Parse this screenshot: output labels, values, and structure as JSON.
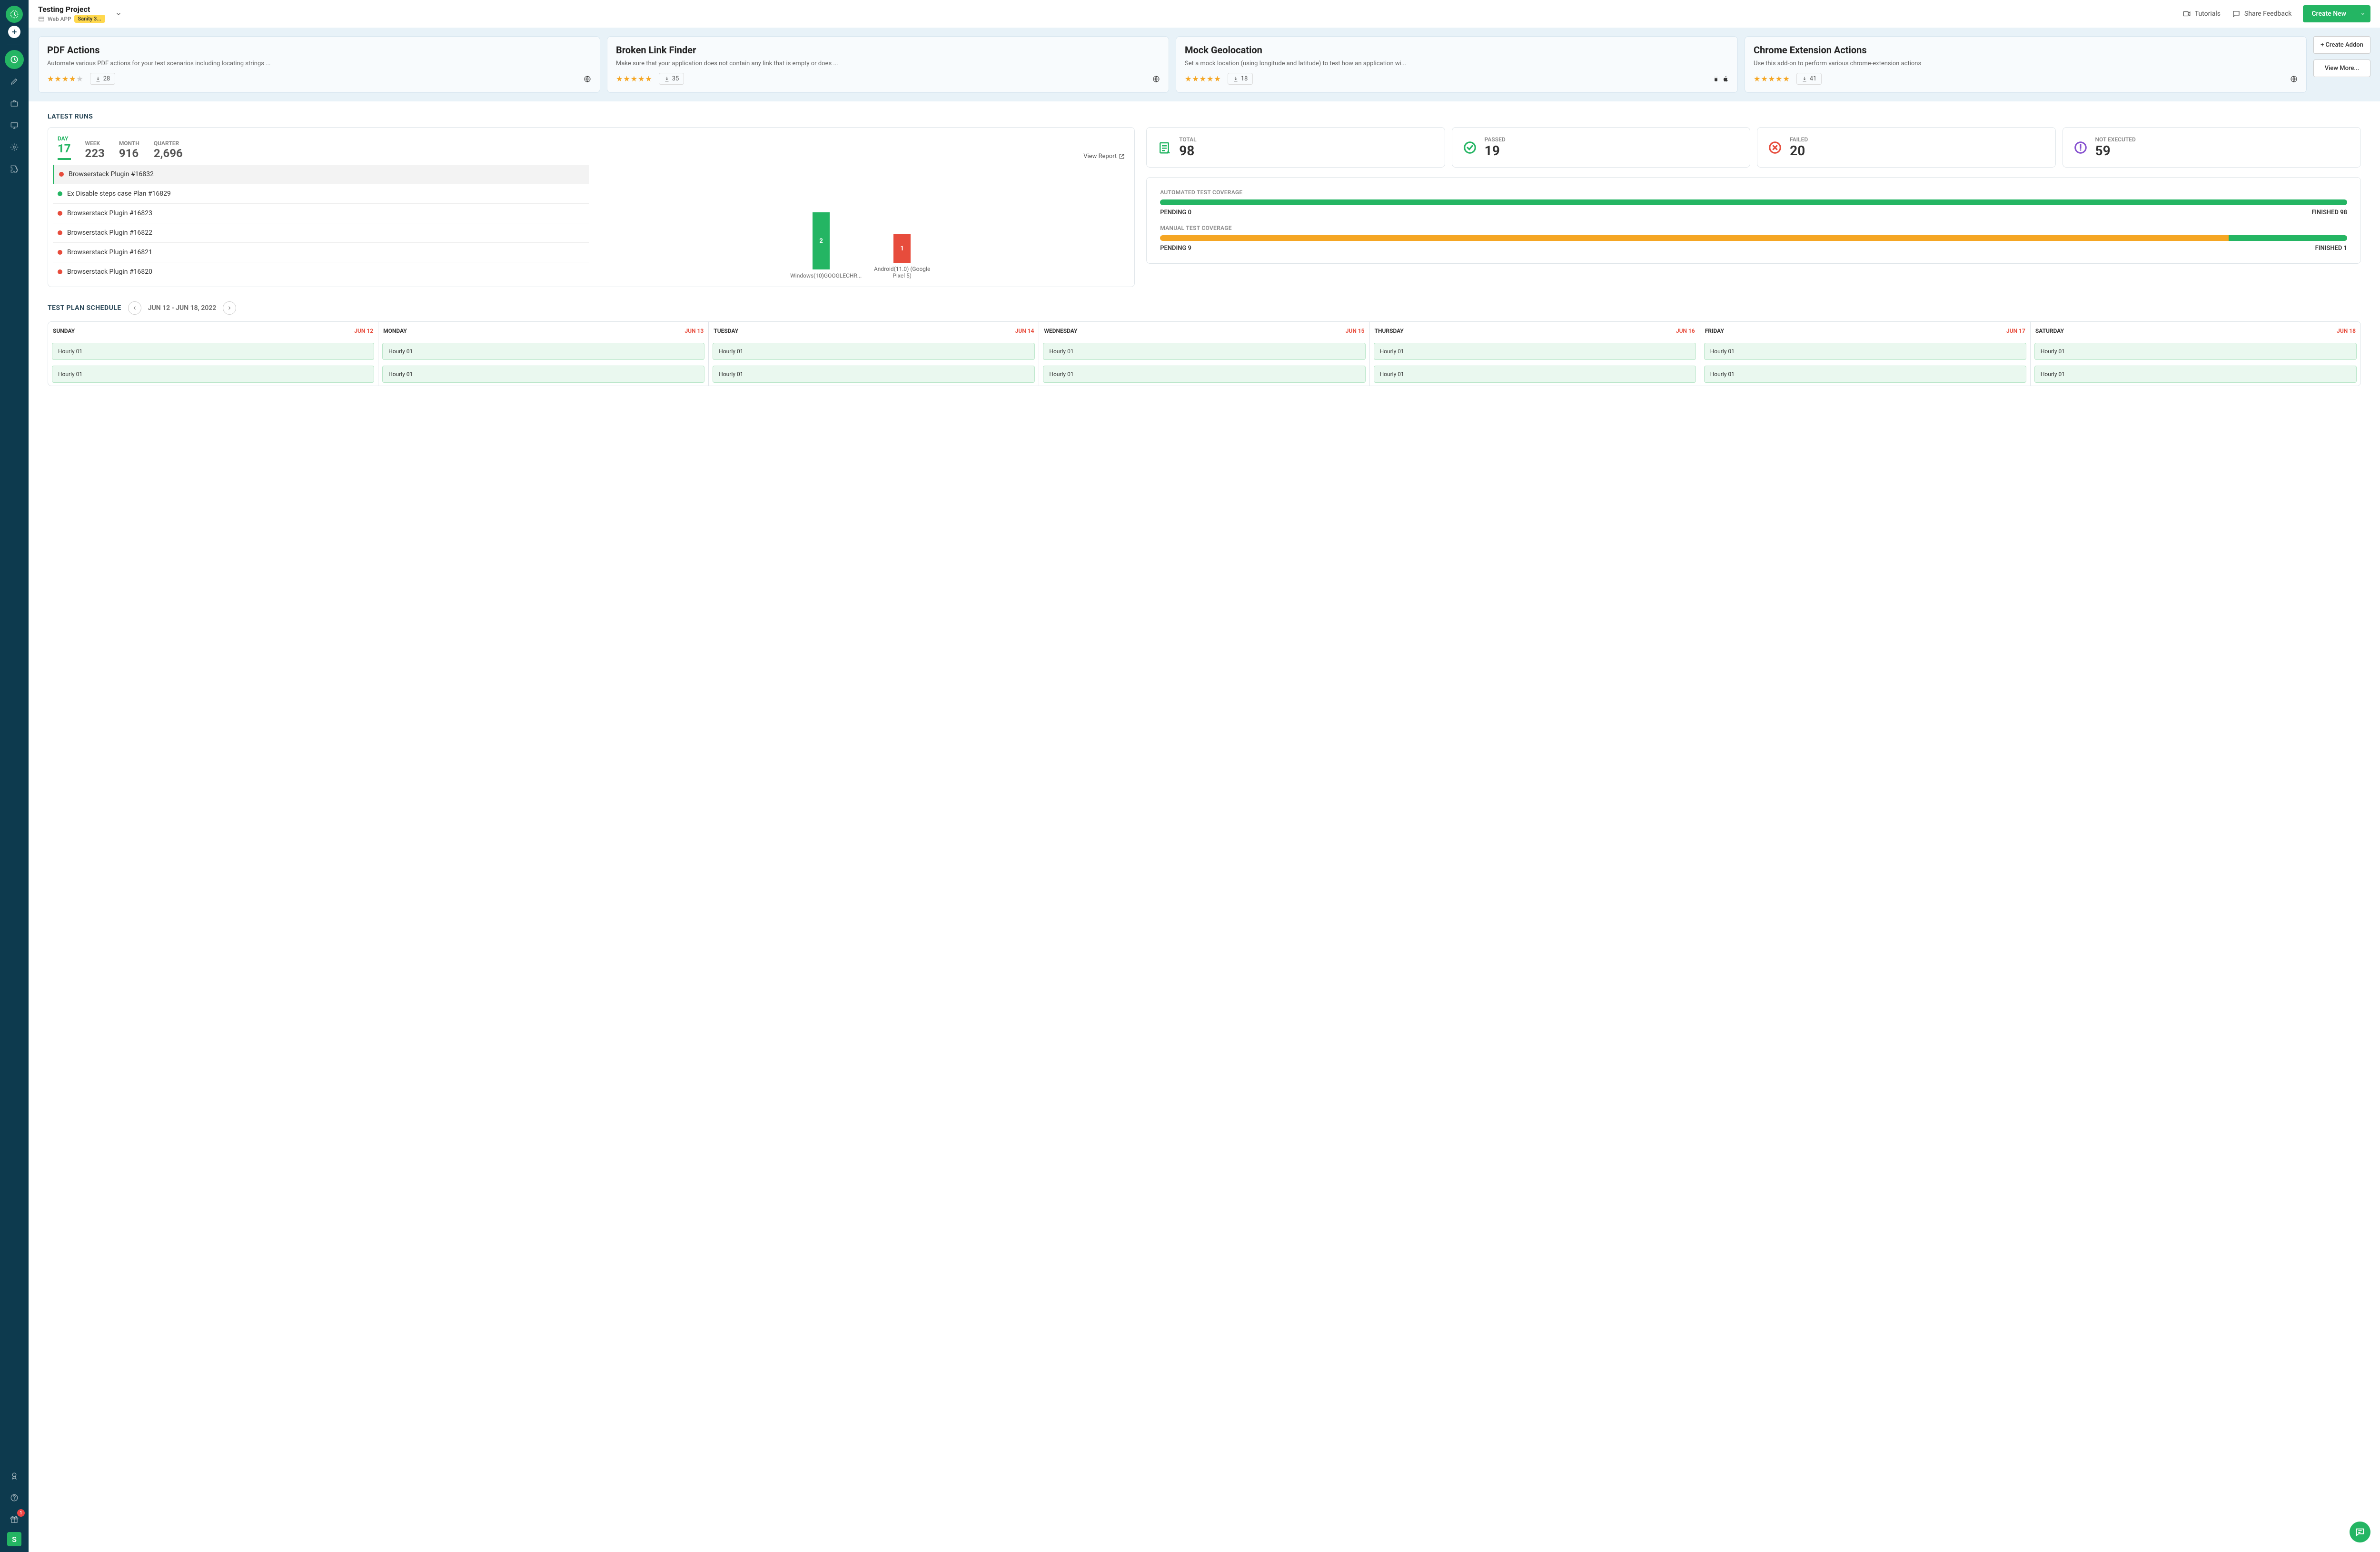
{
  "project": {
    "title": "Testing Project",
    "type": "Web APP",
    "badge": "Sanity 3..."
  },
  "topbar": {
    "tutorials": "Tutorials",
    "feedback": "Share Feedback",
    "create": "Create New"
  },
  "addons": [
    {
      "title": "PDF Actions",
      "desc": "Automate various PDF actions for your test scenarios including locating strings ...",
      "rating": 4,
      "downloads": "28",
      "platforms": [
        "web"
      ]
    },
    {
      "title": "Broken Link Finder",
      "desc": "Make sure that your application does not contain any link that is empty or does ...",
      "rating": 5,
      "downloads": "35",
      "platforms": [
        "web"
      ]
    },
    {
      "title": "Mock Geolocation",
      "desc": "Set a mock location (using longitude and latitude) to test how an application wi...",
      "rating": 5,
      "downloads": "18",
      "platforms": [
        "android",
        "apple"
      ]
    },
    {
      "title": "Chrome Extension Actions",
      "desc": "Use this add-on to perform various chrome-extension actions",
      "rating": 5,
      "downloads": "41",
      "platforms": [
        "web"
      ]
    }
  ],
  "addons_side": {
    "create": "+ Create Addon",
    "more": "View More..."
  },
  "latest_runs": {
    "title": "LATEST RUNS",
    "view_report": "View Report"
  },
  "periods": [
    {
      "label": "DAY",
      "value": "17",
      "active": true
    },
    {
      "label": "WEEK",
      "value": "223"
    },
    {
      "label": "MONTH",
      "value": "916"
    },
    {
      "label": "QUARTER",
      "value": "2,696"
    }
  ],
  "runs": [
    {
      "name": "Browserstack Plugin #16832",
      "status": "red"
    },
    {
      "name": "Ex Disable steps case Plan #16829",
      "status": "green"
    },
    {
      "name": "Browserstack Plugin #16823",
      "status": "red"
    },
    {
      "name": "Browserstack Plugin #16822",
      "status": "red"
    },
    {
      "name": "Browserstack Plugin #16821",
      "status": "red"
    },
    {
      "name": "Browserstack Plugin #16820",
      "status": "red"
    }
  ],
  "chart_data": {
    "type": "bar",
    "categories": [
      "Windows(10)GOOGLECHR...",
      "Android(11.0) (Google Pixel 5)"
    ],
    "values": [
      2,
      1
    ],
    "colors": [
      "#24b563",
      "#e74c3c"
    ]
  },
  "stats": {
    "total": {
      "label": "TOTAL",
      "value": "98"
    },
    "passed": {
      "label": "PASSED",
      "value": "19"
    },
    "failed": {
      "label": "FAILED",
      "value": "20"
    },
    "not_executed": {
      "label": "NOT EXECUTED",
      "value": "59"
    }
  },
  "coverage": {
    "auto": {
      "title": "AUTOMATED TEST COVERAGE",
      "pending": "PENDING 0",
      "finished": "FINISHED 98"
    },
    "manual": {
      "title": "MANUAL TEST COVERAGE",
      "pending": "PENDING 9",
      "finished": "FINISHED 1"
    }
  },
  "schedule": {
    "title": "TEST PLAN SCHEDULE",
    "range": "JUN 12 - JUN 18, 2022"
  },
  "days": [
    {
      "name": "SUNDAY",
      "date": "JUN 12",
      "events": [
        "Hourly 01",
        "Hourly 01"
      ]
    },
    {
      "name": "MONDAY",
      "date": "JUN 13",
      "events": [
        "Hourly 01",
        "Hourly 01"
      ]
    },
    {
      "name": "TUESDAY",
      "date": "JUN 14",
      "events": [
        "Hourly 01",
        "Hourly 01"
      ]
    },
    {
      "name": "WEDNESDAY",
      "date": "JUN 15",
      "events": [
        "Hourly 01",
        "Hourly 01"
      ]
    },
    {
      "name": "THURSDAY",
      "date": "JUN 16",
      "events": [
        "Hourly 01",
        "Hourly 01"
      ]
    },
    {
      "name": "FRIDAY",
      "date": "JUN 17",
      "events": [
        "Hourly 01",
        "Hourly 01"
      ]
    },
    {
      "name": "SATURDAY",
      "date": "JUN 18",
      "events": [
        "Hourly 01",
        "Hourly 01"
      ]
    }
  ],
  "sidebar": {
    "gift_badge": "1",
    "user": "S"
  }
}
